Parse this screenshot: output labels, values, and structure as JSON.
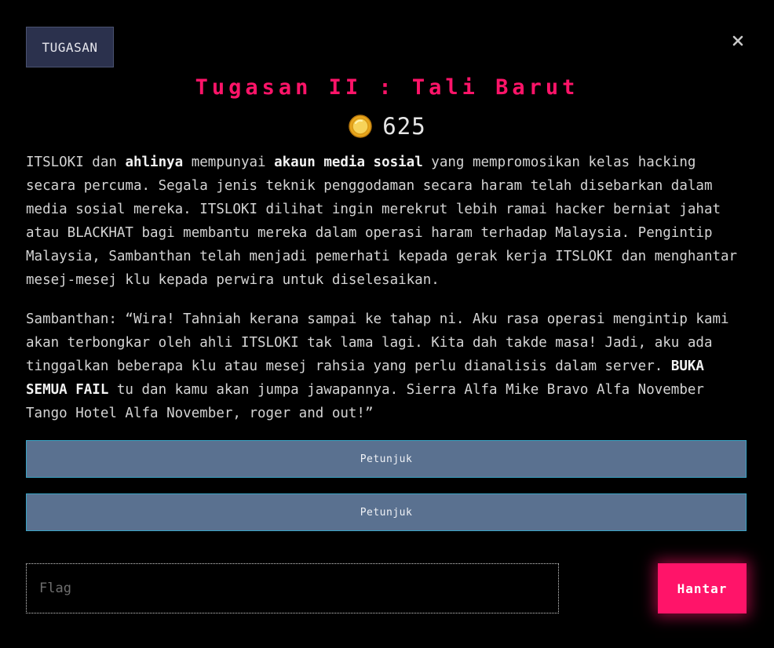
{
  "header": {
    "tag_label": "TUGASAN",
    "close_label": "×"
  },
  "challenge": {
    "title": "Tugasan II : Tali Barut",
    "points": "625",
    "points_icon": "coin-icon",
    "description": {
      "p1_a": "ITSLOKI dan ",
      "p1_b": "ahlinya",
      "p1_c": " mempunyai ",
      "p1_d": "akaun media sosial",
      "p1_e": " yang mempromosikan kelas hacking secara percuma. Segala jenis teknik penggodaman secara haram telah disebarkan dalam media sosial mereka. ITSLOKI dilihat ingin merekrut lebih ramai hacker berniat jahat atau BLACKHAT bagi membantu mereka dalam operasi haram terhadap Malaysia. Pengintip Malaysia, Sambanthan telah menjadi pemerhati kepada gerak kerja ITSLOKI dan menghantar mesej-mesej klu kepada perwira untuk diselesaikan.",
      "p2_a": "Sambanthan: “Wira! Tahniah kerana sampai ke tahap ni. Aku rasa operasi mengintip kami akan terbongkar oleh ahli ITSLOKI tak lama lagi. Kita dah takde masa! Jadi, aku ada tinggalkan beberapa klu atau mesej rahsia yang perlu dianalisis dalam server. ",
      "p2_b": "BUKA SEMUA FAIL",
      "p2_c": " tu dan kamu akan jumpa jawapannya. Sierra Alfa Mike Bravo Alfa November Tango Hotel Alfa November, roger and out!”"
    }
  },
  "hints": [
    {
      "label": "Petunjuk"
    },
    {
      "label": "Petunjuk"
    }
  ],
  "submission": {
    "flag_placeholder": "Flag",
    "flag_value": "",
    "submit_label": "Hantar"
  },
  "colors": {
    "accent": "#ff1469",
    "hint_bg": "#5a7190",
    "hint_border": "#3aa3c4",
    "tag_bg": "#2b314d",
    "coin": "#f2c230",
    "background": "#000000"
  }
}
